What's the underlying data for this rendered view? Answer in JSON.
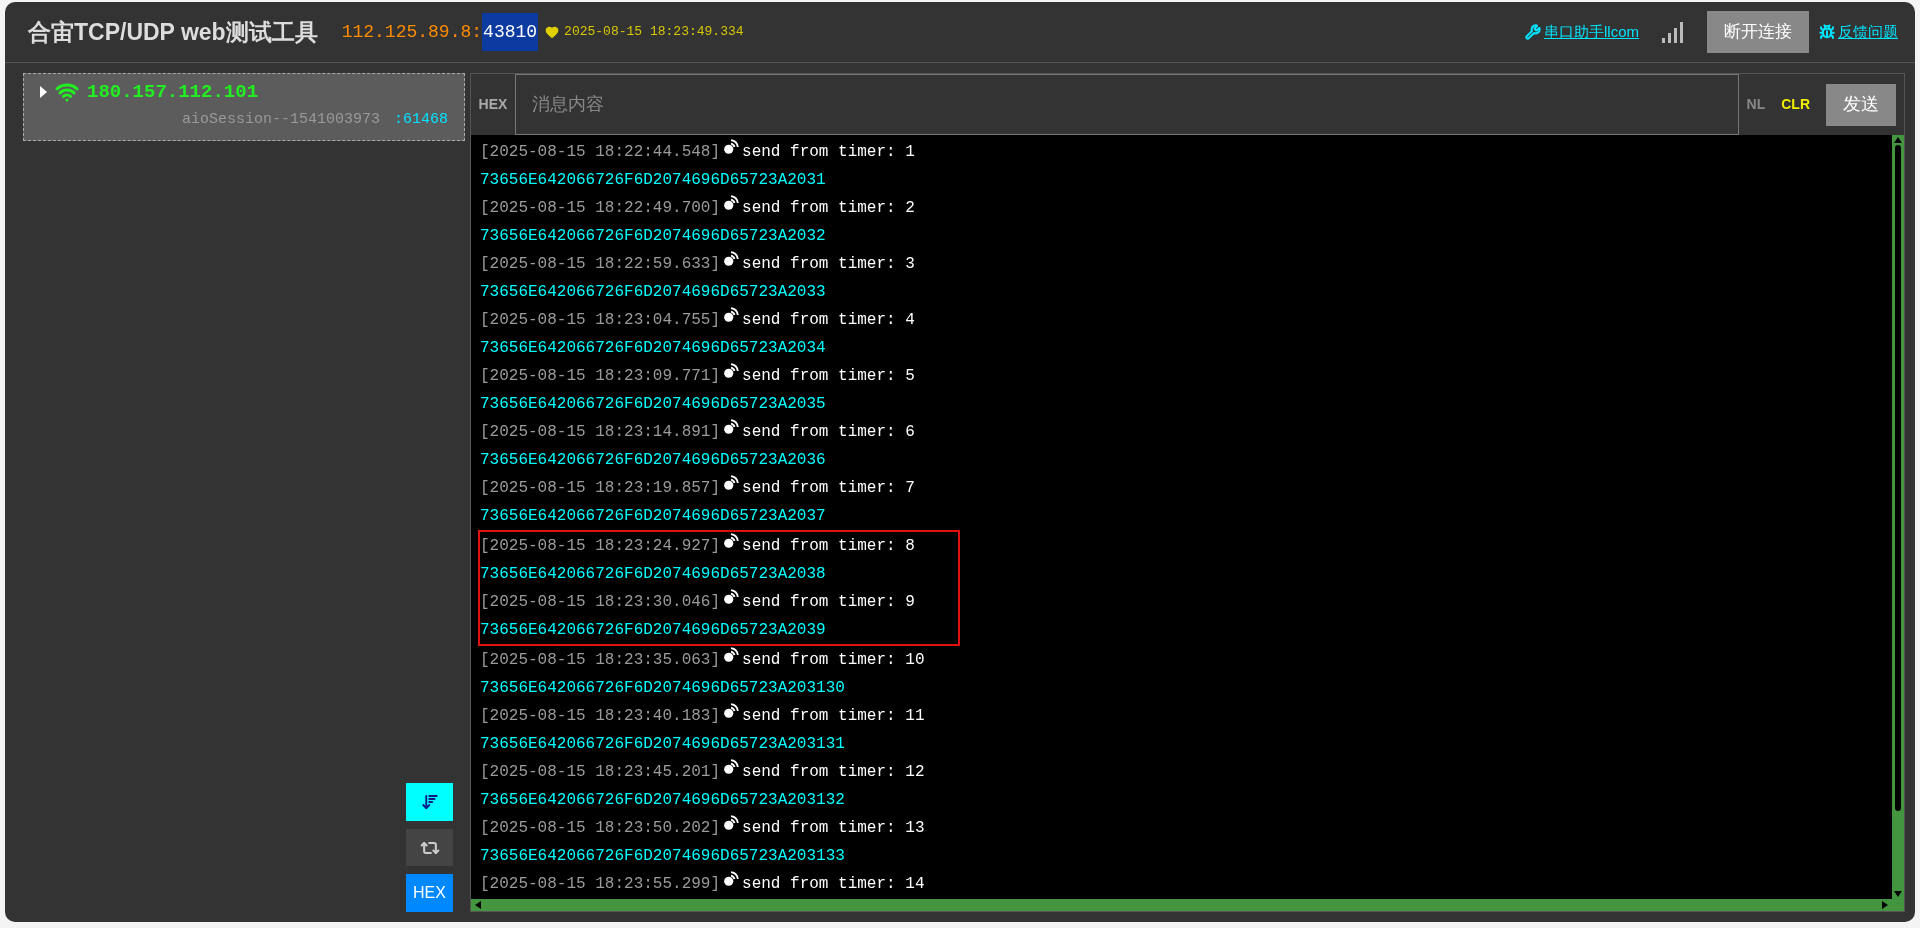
{
  "header": {
    "title": "合宙TCP/UDP web测试工具",
    "host": "112.125.89.8:",
    "port": "43810",
    "heartbeat_time": "2025-08-15 18:23:49.334",
    "links": [
      {
        "kind": "tool",
        "label": "串口助手llcom"
      },
      {
        "kind": "disconnect",
        "label": "断开连接"
      },
      {
        "kind": "bug",
        "label": "反馈问题"
      }
    ]
  },
  "sessions": [
    {
      "ip": "180.157.112.101",
      "name": "aioSession--1541003973",
      "port": ":61468",
      "expanded": false
    }
  ],
  "toggles": [
    {
      "kind": "autoscroll",
      "on": true
    },
    {
      "kind": "loop",
      "on": false
    },
    {
      "kind": "hex",
      "label": "HEX",
      "on": true
    }
  ],
  "composer": {
    "hex_label": "HEX",
    "placeholder": "消息内容",
    "nl_label": "NL",
    "clr_label": "CLR",
    "send_label": "发送"
  },
  "log": [
    {
      "time": "[2025-08-15 18:22:44.548]",
      "text": "send from timer: 1",
      "hex": "73656E642066726F6D2074696D65723A2031",
      "highlighted": false
    },
    {
      "time": "[2025-08-15 18:22:49.700]",
      "text": "send from timer: 2",
      "hex": "73656E642066726F6D2074696D65723A2032",
      "highlighted": false
    },
    {
      "time": "[2025-08-15 18:22:59.633]",
      "text": "send from timer: 3",
      "hex": "73656E642066726F6D2074696D65723A2033",
      "highlighted": false
    },
    {
      "time": "[2025-08-15 18:23:04.755]",
      "text": "send from timer: 4",
      "hex": "73656E642066726F6D2074696D65723A2034",
      "highlighted": false
    },
    {
      "time": "[2025-08-15 18:23:09.771]",
      "text": "send from timer: 5",
      "hex": "73656E642066726F6D2074696D65723A2035",
      "highlighted": false
    },
    {
      "time": "[2025-08-15 18:23:14.891]",
      "text": "send from timer: 6",
      "hex": "73656E642066726F6D2074696D65723A2036",
      "highlighted": false
    },
    {
      "time": "[2025-08-15 18:23:19.857]",
      "text": "send from timer: 7",
      "hex": "73656E642066726F6D2074696D65723A2037",
      "highlighted": false
    },
    {
      "time": "[2025-08-15 18:23:24.927]",
      "text": "send from timer: 8",
      "hex": "73656E642066726F6D2074696D65723A2038",
      "highlighted": true
    },
    {
      "time": "[2025-08-15 18:23:30.046]",
      "text": "send from timer: 9",
      "hex": "73656E642066726F6D2074696D65723A2039",
      "highlighted": true
    },
    {
      "time": "[2025-08-15 18:23:35.063]",
      "text": "send from timer: 10",
      "hex": "73656E642066726F6D2074696D65723A203130",
      "highlighted": false
    },
    {
      "time": "[2025-08-15 18:23:40.183]",
      "text": "send from timer: 11",
      "hex": "73656E642066726F6D2074696D65723A203131",
      "highlighted": false
    },
    {
      "time": "[2025-08-15 18:23:45.201]",
      "text": "send from timer: 12",
      "hex": "73656E642066726F6D2074696D65723A203132",
      "highlighted": false
    },
    {
      "time": "[2025-08-15 18:23:50.202]",
      "text": "send from timer: 13",
      "hex": "73656E642066726F6D2074696D65723A203133",
      "highlighted": false
    },
    {
      "time": "[2025-08-15 18:23:55.299]",
      "text": "send from timer: 14",
      "highlighted": false
    }
  ]
}
